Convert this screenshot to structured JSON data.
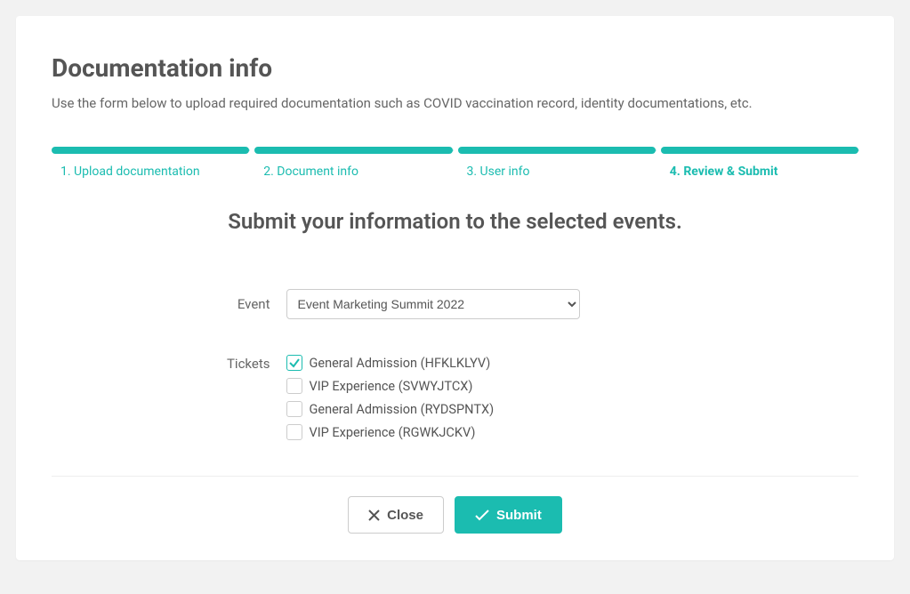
{
  "header": {
    "title": "Documentation info",
    "subtitle": "Use the form below to upload required documentation such as COVID vaccination record, identity documentations, etc."
  },
  "stepper": {
    "items": [
      {
        "label": "1. Upload documentation",
        "active": false
      },
      {
        "label": "2. Document info",
        "active": false
      },
      {
        "label": "3. User info",
        "active": false
      },
      {
        "label": "4. Review & Submit",
        "active": true
      }
    ]
  },
  "section_heading": "Submit your information to the selected events.",
  "form": {
    "event_label": "Event",
    "event_selected": "Event Marketing Summit 2022",
    "tickets_label": "Tickets",
    "tickets": [
      {
        "label": "General Admission (HFKLKLYV)",
        "checked": true
      },
      {
        "label": "VIP Experience (SVWYJTCX)",
        "checked": false
      },
      {
        "label": "General Admission (RYDSPNTX)",
        "checked": false
      },
      {
        "label": "VIP Experience (RGWKJCKV)",
        "checked": false
      }
    ]
  },
  "footer": {
    "close_label": "Close",
    "submit_label": "Submit"
  },
  "colors": {
    "accent": "#1bbcb0"
  }
}
